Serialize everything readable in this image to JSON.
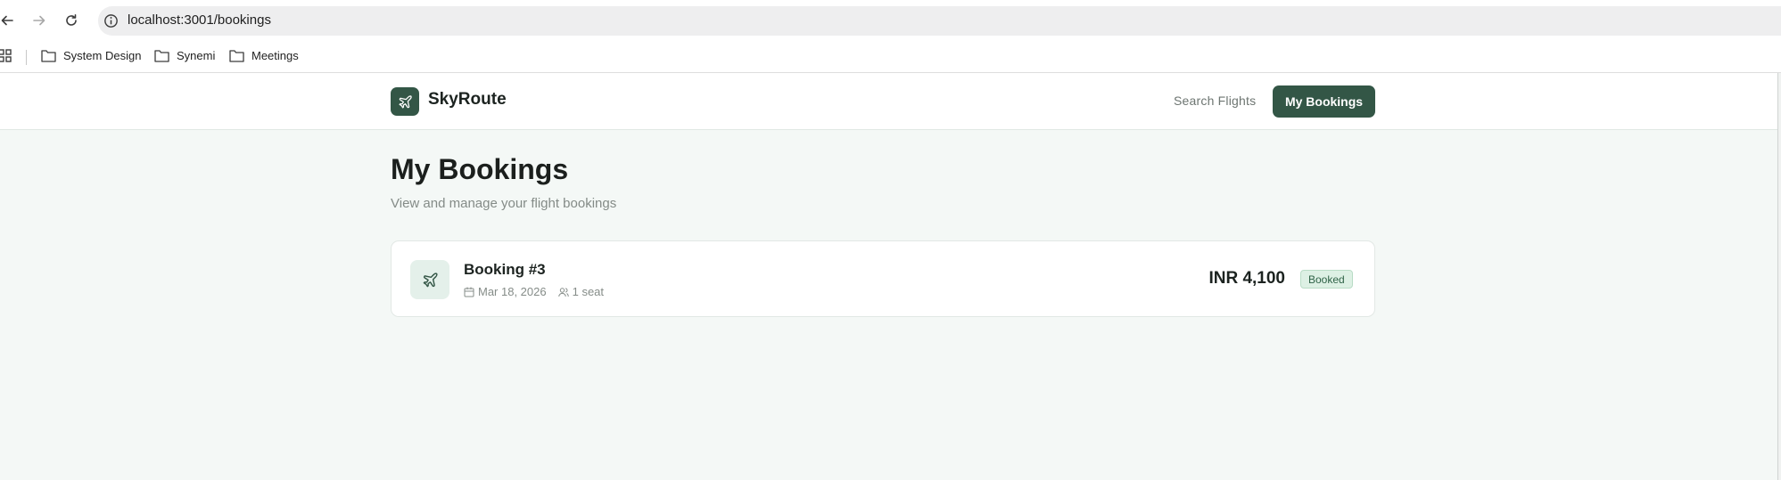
{
  "browser": {
    "url": "localhost:3001/bookings",
    "bookmarks": [
      {
        "label": "System Design"
      },
      {
        "label": "Synemi"
      },
      {
        "label": "Meetings"
      }
    ]
  },
  "header": {
    "brand": "SkyRoute",
    "nav": {
      "search_label": "Search Flights",
      "bookings_label": "My Bookings"
    }
  },
  "main": {
    "title": "My Bookings",
    "subtitle": "View and manage your flight bookings",
    "bookings": [
      {
        "title": "Booking #3",
        "date": "Mar 18, 2026",
        "seats": "1 seat",
        "price": "INR 4,100",
        "status": "Booked"
      }
    ]
  },
  "colors": {
    "brand": "#335646",
    "page_background": "#f4f8f6",
    "badge_background": "#ddf0e4"
  }
}
